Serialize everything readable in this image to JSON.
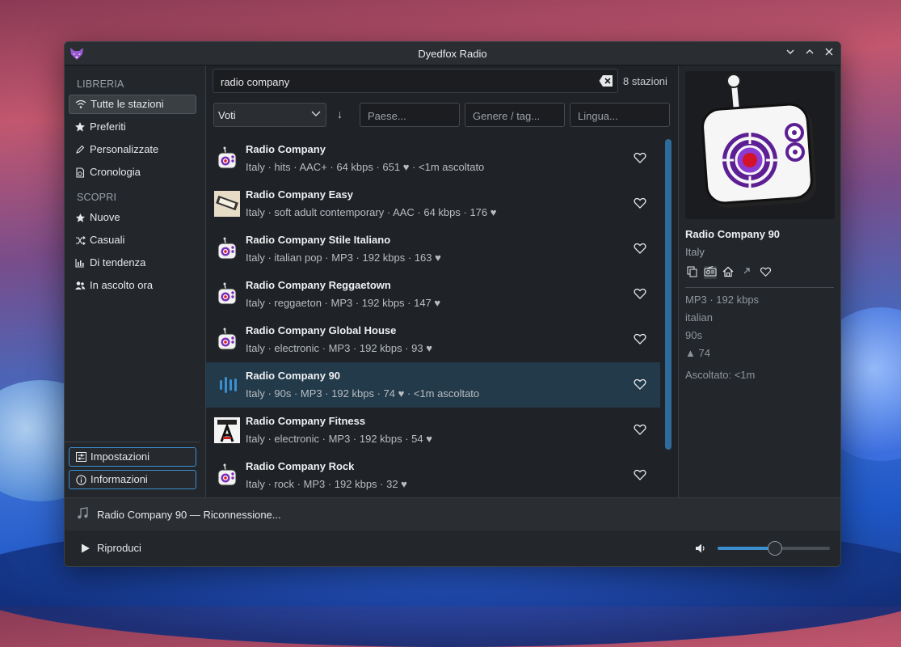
{
  "window": {
    "title": "Dyedfox Radio"
  },
  "sidebar": {
    "library_title": "LIBRERIA",
    "library_items": [
      {
        "label": "Tutte le stazioni",
        "icon": "wifi-icon",
        "active": true
      },
      {
        "label": "Preferiti",
        "icon": "star-icon"
      },
      {
        "label": "Personalizzate",
        "icon": "pencil-icon"
      },
      {
        "label": "Cronologia",
        "icon": "history-icon"
      }
    ],
    "discover_title": "SCOPRI",
    "discover_items": [
      {
        "label": "Nuove",
        "icon": "star-icon"
      },
      {
        "label": "Casuali",
        "icon": "shuffle-icon"
      },
      {
        "label": "Di tendenza",
        "icon": "trending-icon"
      },
      {
        "label": "In ascolto ora",
        "icon": "listeners-icon"
      }
    ],
    "settings_label": "Impostazioni",
    "info_label": "Informazioni"
  },
  "search": {
    "value": "radio company",
    "count": "8 stazioni"
  },
  "filters": {
    "sort_value": "Voti",
    "sort_direction": "↓",
    "country_placeholder": "Paese...",
    "genre_placeholder": "Genere / tag...",
    "language_placeholder": "Lingua..."
  },
  "stations": [
    {
      "name": "Radio Company",
      "meta": "Italy  ·  hits  ·  AAC+  ·  64 kbps  ·  651 ♥  ·  <1m ascoltato",
      "thumb": "radio"
    },
    {
      "name": "Radio Company Easy",
      "meta": "Italy  ·  soft adult contemporary  ·  AAC  ·  64 kbps  ·  176 ♥",
      "thumb": "easy-logo"
    },
    {
      "name": "Radio Company Stile Italiano",
      "meta": "Italy  ·  italian pop  ·  MP3  ·  192 kbps  ·  163 ♥",
      "thumb": "radio"
    },
    {
      "name": "Radio Company Reggaetown",
      "meta": "Italy  ·  reggaeton  ·  MP3  ·  192 kbps  ·  147 ♥",
      "thumb": "radio"
    },
    {
      "name": "Radio Company Global House",
      "meta": "Italy  ·  electronic  ·  MP3  ·  192 kbps  ·  93 ♥",
      "thumb": "radio"
    },
    {
      "name": "Radio Company 90",
      "meta": "Italy  ·  90s  ·  MP3  ·  192 kbps  ·  74 ♥  ·  <1m ascoltato",
      "thumb": "playing",
      "selected": true
    },
    {
      "name": "Radio Company Fitness",
      "meta": "Italy  ·  electronic  ·  MP3  ·  192 kbps  ·  54 ♥",
      "thumb": "fitness-logo"
    },
    {
      "name": "Radio Company Rock",
      "meta": "Italy  ·  rock  ·  MP3  ·  192 kbps  ·  32 ♥",
      "thumb": "radio"
    }
  ],
  "details": {
    "name": "Radio Company 90",
    "country": "Italy",
    "codec": "MP3  ·  192 kbps",
    "language": "italian",
    "tag": "90s",
    "votes": "▲ 74",
    "listened": "Ascoltato: <1m"
  },
  "now_playing": {
    "text": "Radio Company 90  —  Riconnessione..."
  },
  "controls": {
    "play_label": "Riproduci",
    "volume": 0.5
  },
  "colors": {
    "accent": "#3b8fd0",
    "selected_row": "#233a4a",
    "window_bg": "#1f2226"
  }
}
